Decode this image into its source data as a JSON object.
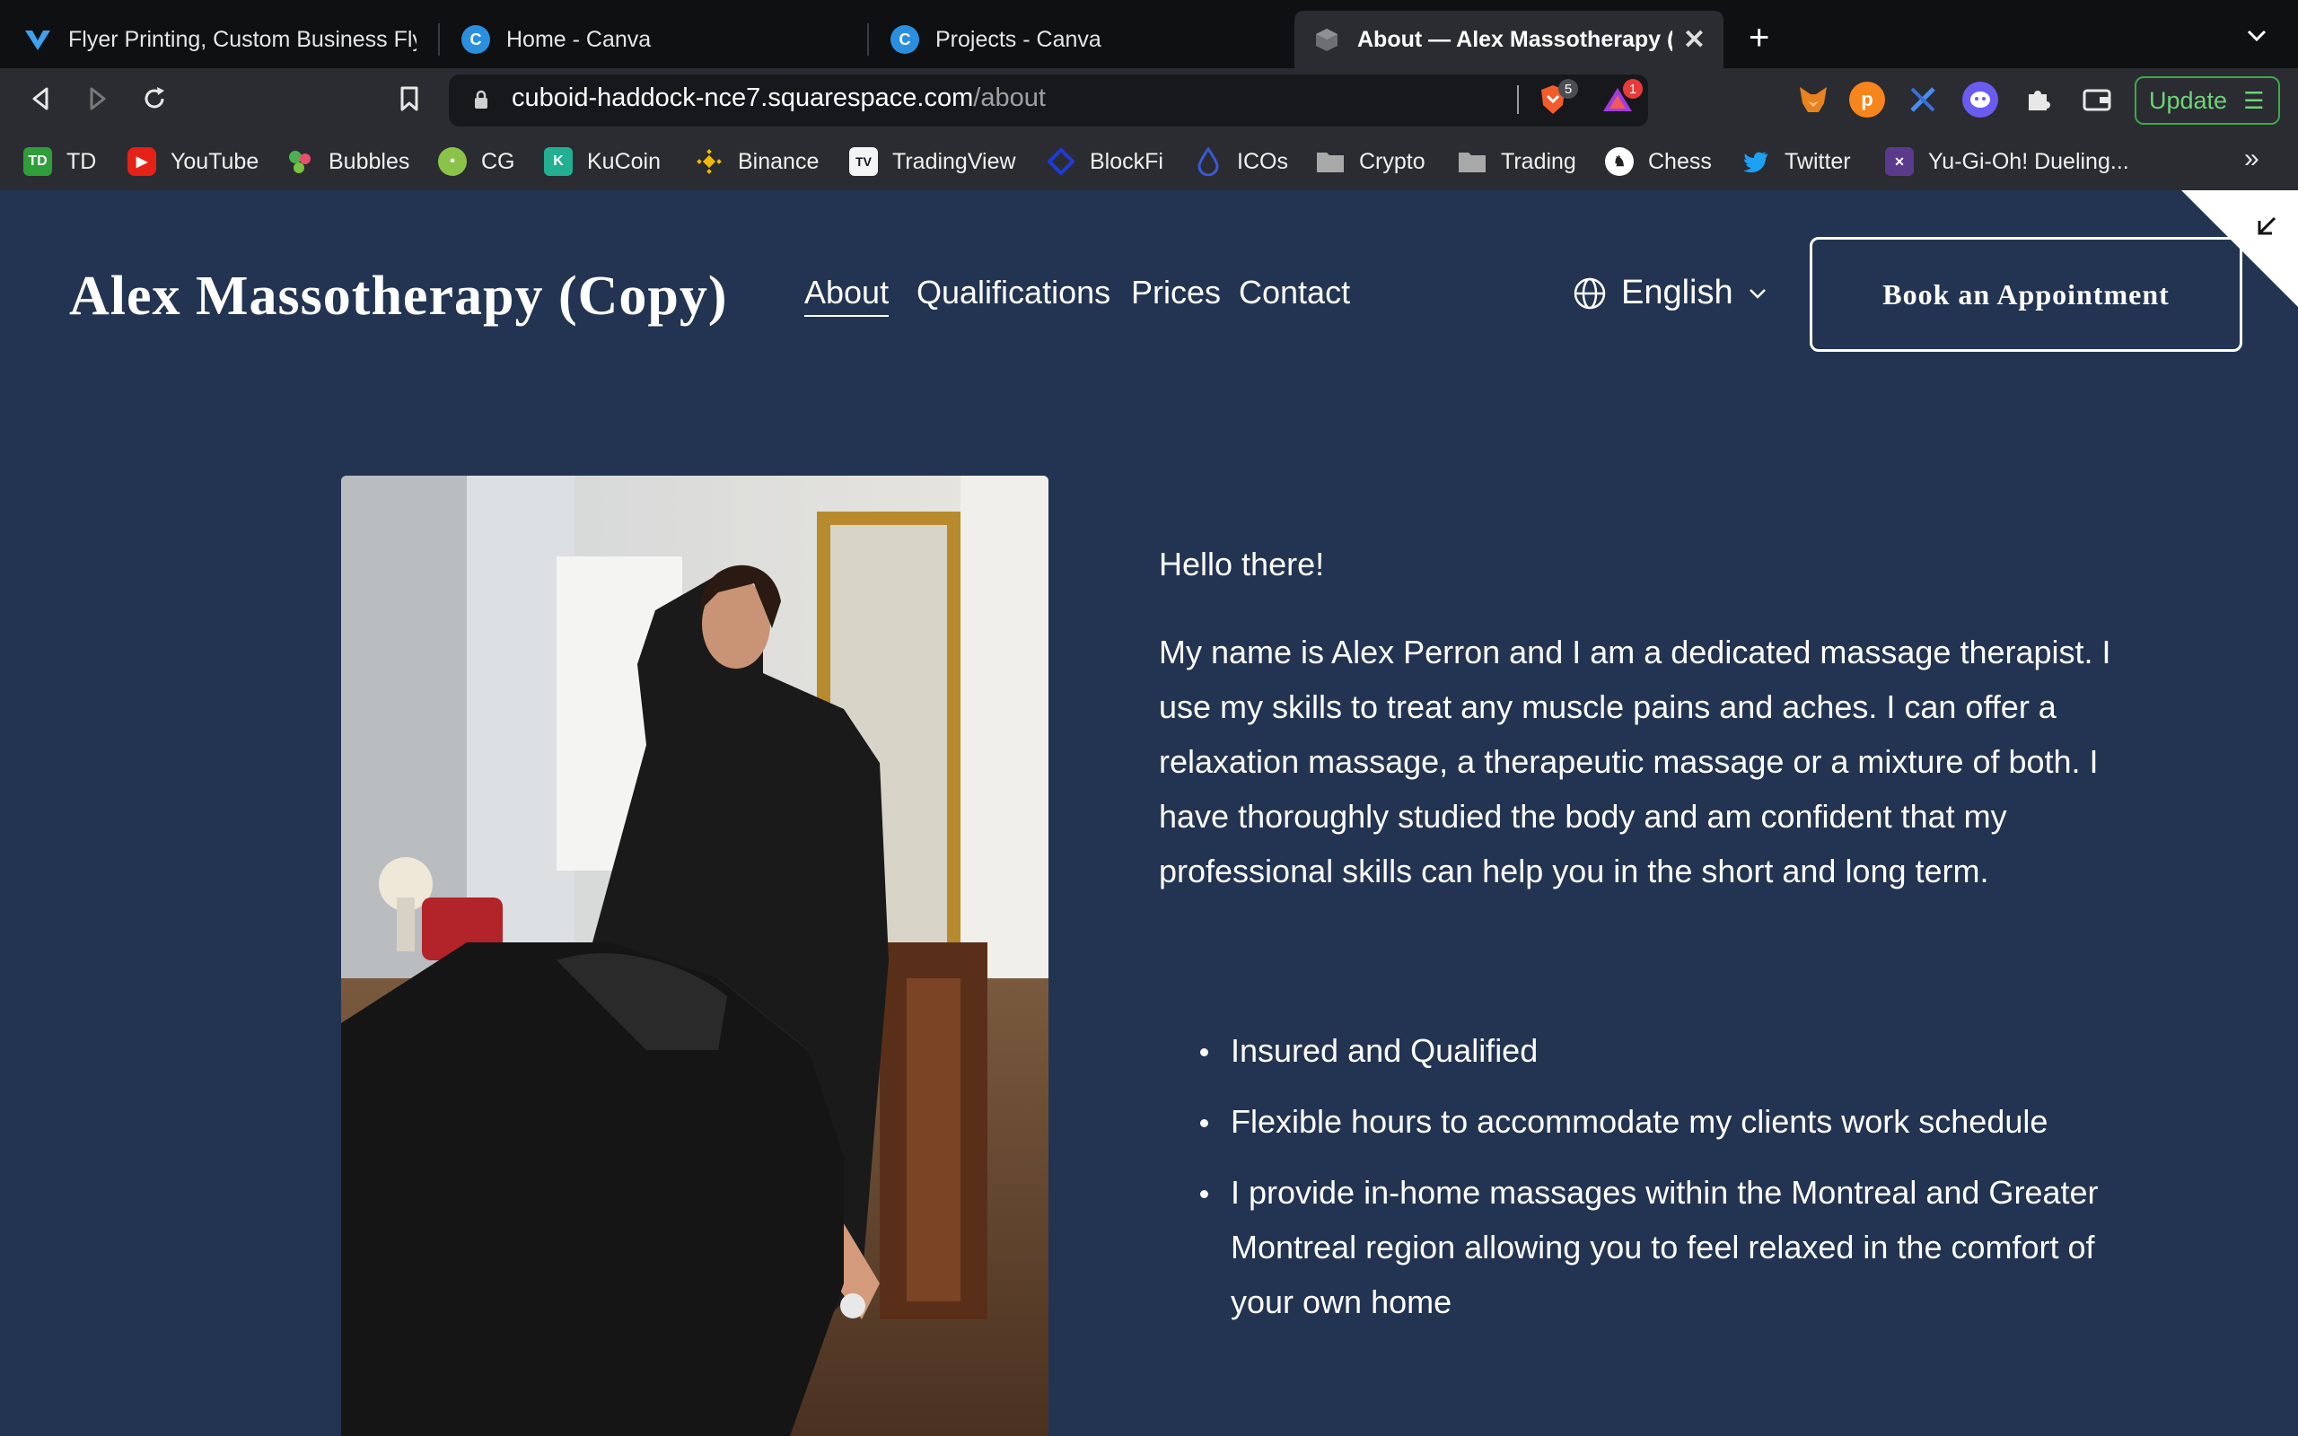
{
  "tabs": [
    {
      "label": "Flyer Printing, Custom Business Flye",
      "favicon": "vistaprint-icon",
      "color": "#1f7fd6"
    },
    {
      "label": "Home - Canva",
      "favicon": "canva-icon",
      "color": "#2b8fe0"
    },
    {
      "label": "Projects - Canva",
      "favicon": "canva-icon",
      "color": "#2b8fe0"
    },
    {
      "label": "About — Alex Massotherapy (Co",
      "favicon": "squarespace-cube-icon",
      "color": "#6d6f75",
      "active": true
    }
  ],
  "toolbar": {
    "url_host": "cuboid-haddock-nce7.squarespace.com",
    "url_path": "/about",
    "brave_badge": "5",
    "rewards_badge": "1",
    "update_label": "Update"
  },
  "bookmarks": [
    {
      "label": "TD",
      "icon": "td-icon",
      "color": "#2e9e3a"
    },
    {
      "label": "YouTube",
      "icon": "youtube-icon",
      "color": "#e62117"
    },
    {
      "label": "Bubbles",
      "icon": "bubbles-icon",
      "color": "#4caf50"
    },
    {
      "label": "CG",
      "icon": "coingecko-icon",
      "color": "#8bc34a"
    },
    {
      "label": "KuCoin",
      "icon": "kucoin-icon",
      "color": "#23af91"
    },
    {
      "label": "Binance",
      "icon": "binance-icon",
      "color": "#f0b90b"
    },
    {
      "label": "TradingView",
      "icon": "tradingview-icon",
      "color": "#131722"
    },
    {
      "label": "BlockFi",
      "icon": "blockfi-icon",
      "color": "#1f3bd6"
    },
    {
      "label": "ICOs",
      "icon": "ico-drop-icon",
      "color": "#3a59d6"
    },
    {
      "label": "Crypto",
      "icon": "folder-icon",
      "color": "#9a9a9a"
    },
    {
      "label": "Trading",
      "icon": "folder-icon",
      "color": "#9a9a9a"
    },
    {
      "label": "Chess",
      "icon": "chess-icon",
      "color": "#ffffff"
    },
    {
      "label": "Twitter",
      "icon": "twitter-icon",
      "color": "#1da1f2"
    },
    {
      "label": "Yu-Gi-Oh! Dueling...",
      "icon": "yugioh-icon",
      "color": "#5b3a8c"
    }
  ],
  "site": {
    "logo": "Alex Massotherapy (Copy)",
    "nav": [
      "About",
      "Qualifications",
      "Prices",
      "Contact"
    ],
    "language": "English",
    "book_label": "Book an Appointment",
    "greeting": "Hello there!",
    "intro": "My name is Alex Perron and I am a dedicated massage therapist. I use my skills to treat any muscle pains and aches. I can offer a relaxation massage, a therapeutic massage or a mixture of both. I have thoroughly studied the body and am confident that my professional skills can help you in the short and long term.",
    "bullets": [
      "Insured and Qualified",
      "Flexible hours to accommodate my clients work schedule",
      "I provide in-home massages within the Montreal and Greater Montreal region allowing you to feel relaxed in the comfort of your own home"
    ],
    "background_color": "#233452"
  }
}
